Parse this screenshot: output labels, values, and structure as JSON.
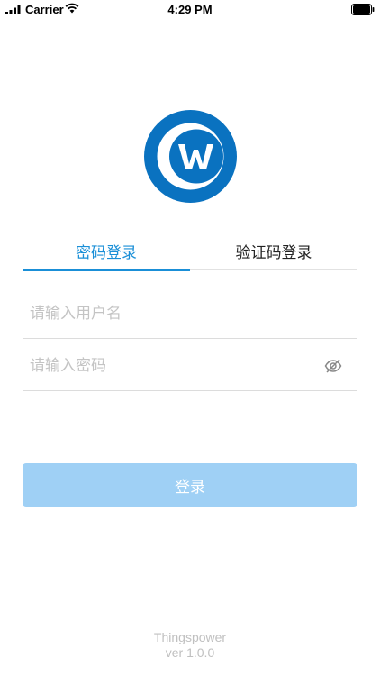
{
  "status_bar": {
    "carrier": "Carrier",
    "time": "4:29 PM",
    "icons": [
      "signal-icon",
      "wifi-icon",
      "battery-icon"
    ]
  },
  "logo": {
    "icon": "company-logo-icon",
    "color": "#0a72c0"
  },
  "tabs": [
    {
      "label": "密码登录",
      "active": true
    },
    {
      "label": "验证码登录",
      "active": false
    }
  ],
  "username": {
    "placeholder": "请输入用户名",
    "value": ""
  },
  "password": {
    "placeholder": "请输入密码",
    "value": "",
    "toggle_icon": "eye-off-icon"
  },
  "login_button": {
    "label": "登录",
    "color": "#9fd0f5"
  },
  "footer": {
    "brand": "Thingspower",
    "version": "ver 1.0.0"
  },
  "colors": {
    "accent": "#1a8fd7",
    "muted_text": "#c0c0c0"
  }
}
